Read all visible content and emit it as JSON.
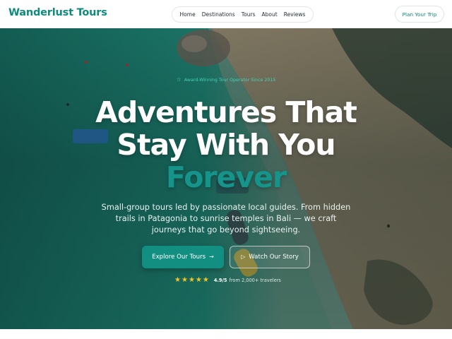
{
  "brand": {
    "name": "Wanderlust Tours"
  },
  "nav": {
    "items": [
      {
        "label": "Home"
      },
      {
        "label": "Destinations"
      },
      {
        "label": "Tours"
      },
      {
        "label": "About"
      },
      {
        "label": "Reviews"
      }
    ]
  },
  "header_cta": {
    "label": "Plan Your Trip"
  },
  "hero": {
    "badge": {
      "icon": "star-outline-icon",
      "text": "Award-Winning Tour Operator Since 2015"
    },
    "headline": {
      "line1": "Adventures That",
      "line2": "Stay With You",
      "accent": "Forever"
    },
    "subtext": "Small-group tours led by passionate local guides. From hidden trails in Patagonia to sunrise temples in Bali — we craft journeys that go beyond sightseeing.",
    "primary_button": {
      "label": "Explore Our Tours",
      "icon": "arrow-right-icon"
    },
    "secondary_button": {
      "label": "Watch Our Story",
      "icon": "play-icon"
    },
    "rating": {
      "stars": 5,
      "score": "4.9/5",
      "text": "from 2,000+ travelers"
    }
  },
  "colors": {
    "brand": "#0f8a7e",
    "primary_button": "#138f82",
    "accent_text": "#14948a",
    "badge_text": "#44d3b5",
    "star": "#f6c326"
  }
}
